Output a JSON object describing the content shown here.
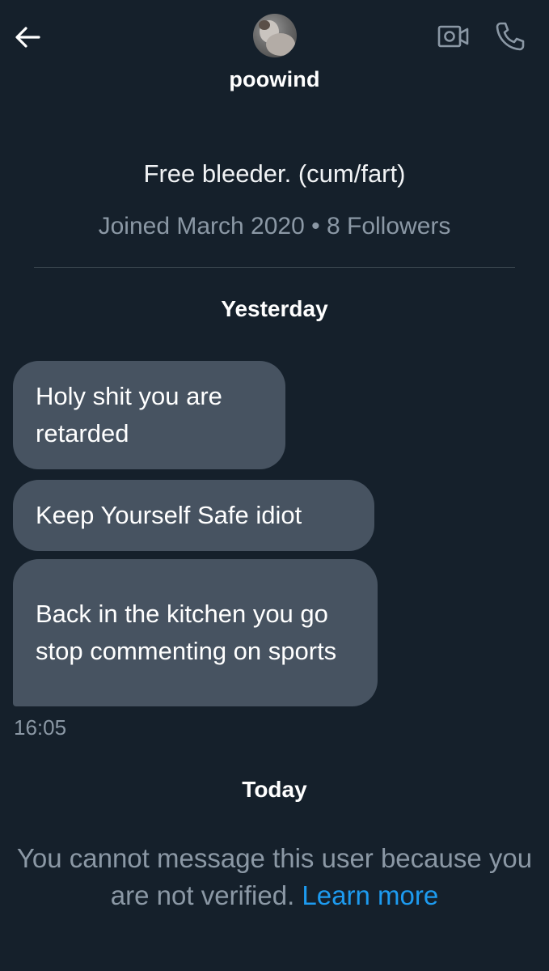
{
  "header": {
    "back_icon": "arrow-left-icon",
    "username": "poowind",
    "video_icon": "video-call-icon",
    "call_icon": "phone-icon"
  },
  "profile": {
    "bio": "Free bleeder. (cum/fart)",
    "joined": "Joined March 2020",
    "separator": " • ",
    "followers": "8 Followers"
  },
  "conversation": {
    "day1_label": "Yesterday",
    "messages": [
      {
        "text": "Holy shit you are retarded"
      },
      {
        "text": "Keep Yourself Safe idiot"
      },
      {
        "text": "Back in the kitchen you go stop commenting on sports"
      }
    ],
    "timestamp": "16:05",
    "day2_label": "Today"
  },
  "notice": {
    "text": "You cannot message this user because you are not verified.",
    "link": "Learn more"
  },
  "colors": {
    "background": "#15202b",
    "bubble": "#475361",
    "muted_text": "#8b98a5",
    "link": "#1d9bf0"
  }
}
